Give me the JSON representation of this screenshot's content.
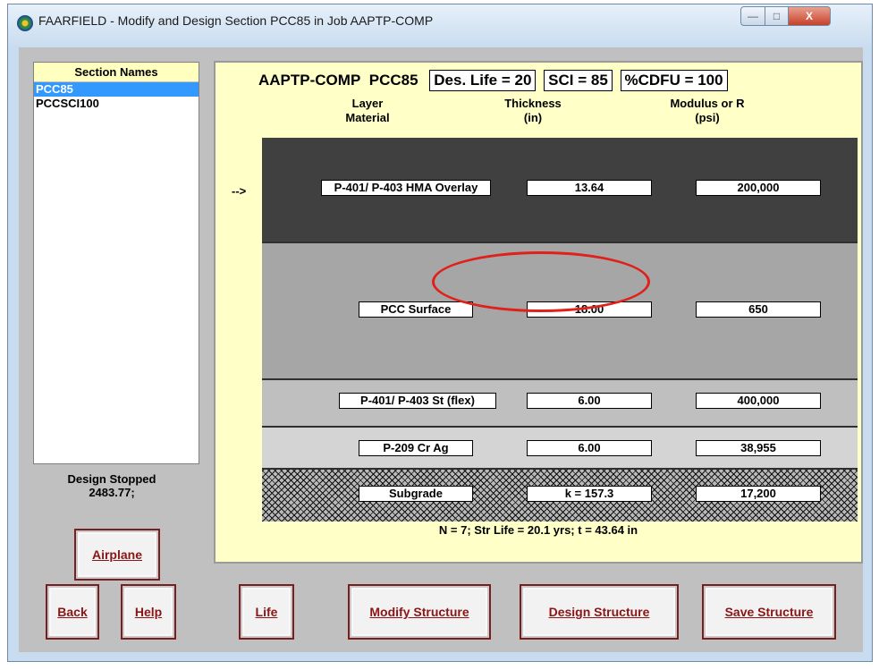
{
  "window": {
    "title": "FAARFIELD - Modify and Design Section PCC85 in Job AAPTP-COMP",
    "min_symbol": "—",
    "max_symbol": "□",
    "close_symbol": "X"
  },
  "sections": {
    "header": "Section Names",
    "items": [
      {
        "label": "PCC85",
        "selected": true
      },
      {
        "label": "PCCSCI100",
        "selected": false
      }
    ]
  },
  "status": {
    "line1": "Design Stopped",
    "line2": "2483.77;"
  },
  "buttons": {
    "airplane": "Airplane",
    "back": "Back",
    "help": "Help",
    "life": "Life",
    "modify": "Modify Structure",
    "design": "Design Structure",
    "save": "Save Structure"
  },
  "structure": {
    "job": "AAPTP-COMP",
    "section": "PCC85",
    "des_life": "Des. Life = 20",
    "sci": "SCI = 85",
    "cdfu": "%CDFU = 100",
    "col_layer_1": "Layer",
    "col_layer_2": "Material",
    "col_thick_1": "Thickness",
    "col_thick_2": "(in)",
    "col_mod_1": "Modulus or R",
    "col_mod_2": "(psi)",
    "arrow": "-->",
    "layers": [
      {
        "material": "P-401/ P-403 HMA Overlay",
        "thickness": "13.64",
        "modulus": "200,000"
      },
      {
        "material": "PCC Surface",
        "thickness": "18.00",
        "modulus": "650"
      },
      {
        "material": "P-401/ P-403 St (flex)",
        "thickness": "6.00",
        "modulus": "400,000"
      },
      {
        "material": "P-209 Cr Ag",
        "thickness": "6.00",
        "modulus": "38,955"
      },
      {
        "material": "Subgrade",
        "thickness": "k = 157.3",
        "modulus": "17,200"
      }
    ],
    "summary": "N = 7;  Str Life = 20.1 yrs;  t = 43.64 in"
  },
  "colors": {
    "panel_bg": "#ffffc8",
    "selection": "#3399ff",
    "button_text": "#8b1515",
    "highlight": "#e0201a"
  }
}
